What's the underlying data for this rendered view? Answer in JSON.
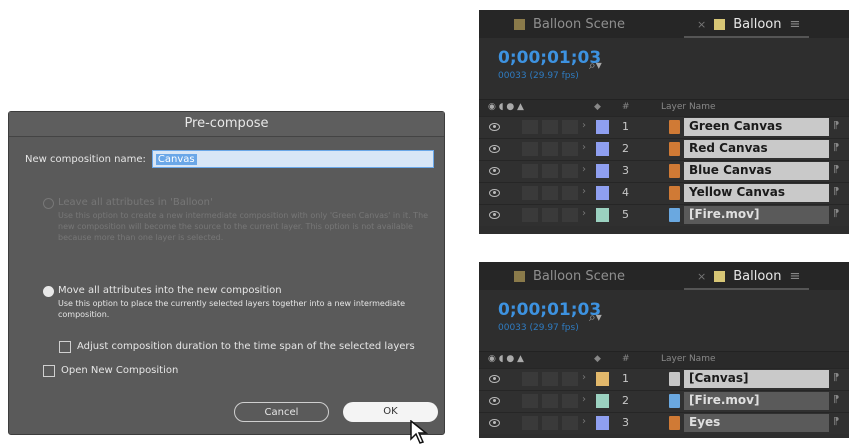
{
  "dialog": {
    "title": "Pre-compose",
    "name_label": "New composition name:",
    "name_value": "Canvas",
    "option1": {
      "title": "Leave all attributes in 'Balloon'",
      "desc": "Use this option to create a new intermediate composition with only 'Green Canvas' in it. The new composition will become the source to the current layer. This option is not available because more than one layer is selected."
    },
    "option2": {
      "title": "Move all attributes into the new composition",
      "desc": "Use this option to place the currently selected layers together into a new intermediate composition."
    },
    "adjust_label": "Adjust composition duration to the time span of the selected layers",
    "open_label": "Open New Composition",
    "cancel_label": "Cancel",
    "ok_label": "OK"
  },
  "panel1": {
    "tab1": "Balloon Scene",
    "tab2": "Balloon",
    "timecode": "0;00;01;03",
    "fps": "00033 (29.97 fps)",
    "search_icon": "⌕",
    "header": {
      "hash": "#",
      "layer_name": "Layer Name"
    },
    "layers": [
      {
        "num": "1",
        "name": "Green Canvas",
        "label_color": "#8f9ff0",
        "icon_color": "#d07a35"
      },
      {
        "num": "2",
        "name": "Red Canvas",
        "label_color": "#8f9ff0",
        "icon_color": "#d07a35"
      },
      {
        "num": "3",
        "name": "Blue Canvas",
        "label_color": "#8f9ff0",
        "icon_color": "#d07a35"
      },
      {
        "num": "4",
        "name": "Yellow Canvas",
        "label_color": "#8f9ff0",
        "icon_color": "#d07a35"
      },
      {
        "num": "5",
        "name": "[Fire.mov]",
        "label_color": "#9bd1c0",
        "icon_color": "#6aa8e0"
      }
    ]
  },
  "panel2": {
    "tab1": "Balloon Scene",
    "tab2": "Balloon",
    "timecode": "0;00;01;03",
    "fps": "00033 (29.97 fps)",
    "header": {
      "hash": "#",
      "layer_name": "Layer Name"
    },
    "layers": [
      {
        "num": "1",
        "name": "[Canvas]",
        "label_color": "#e2b86b",
        "icon_color": "#c7c7c7"
      },
      {
        "num": "2",
        "name": "[Fire.mov]",
        "label_color": "#9bd1c0",
        "icon_color": "#6aa8e0"
      },
      {
        "num": "3",
        "name": "Eyes",
        "label_color": "#8f9ff0",
        "icon_color": "#d07a35"
      }
    ]
  }
}
